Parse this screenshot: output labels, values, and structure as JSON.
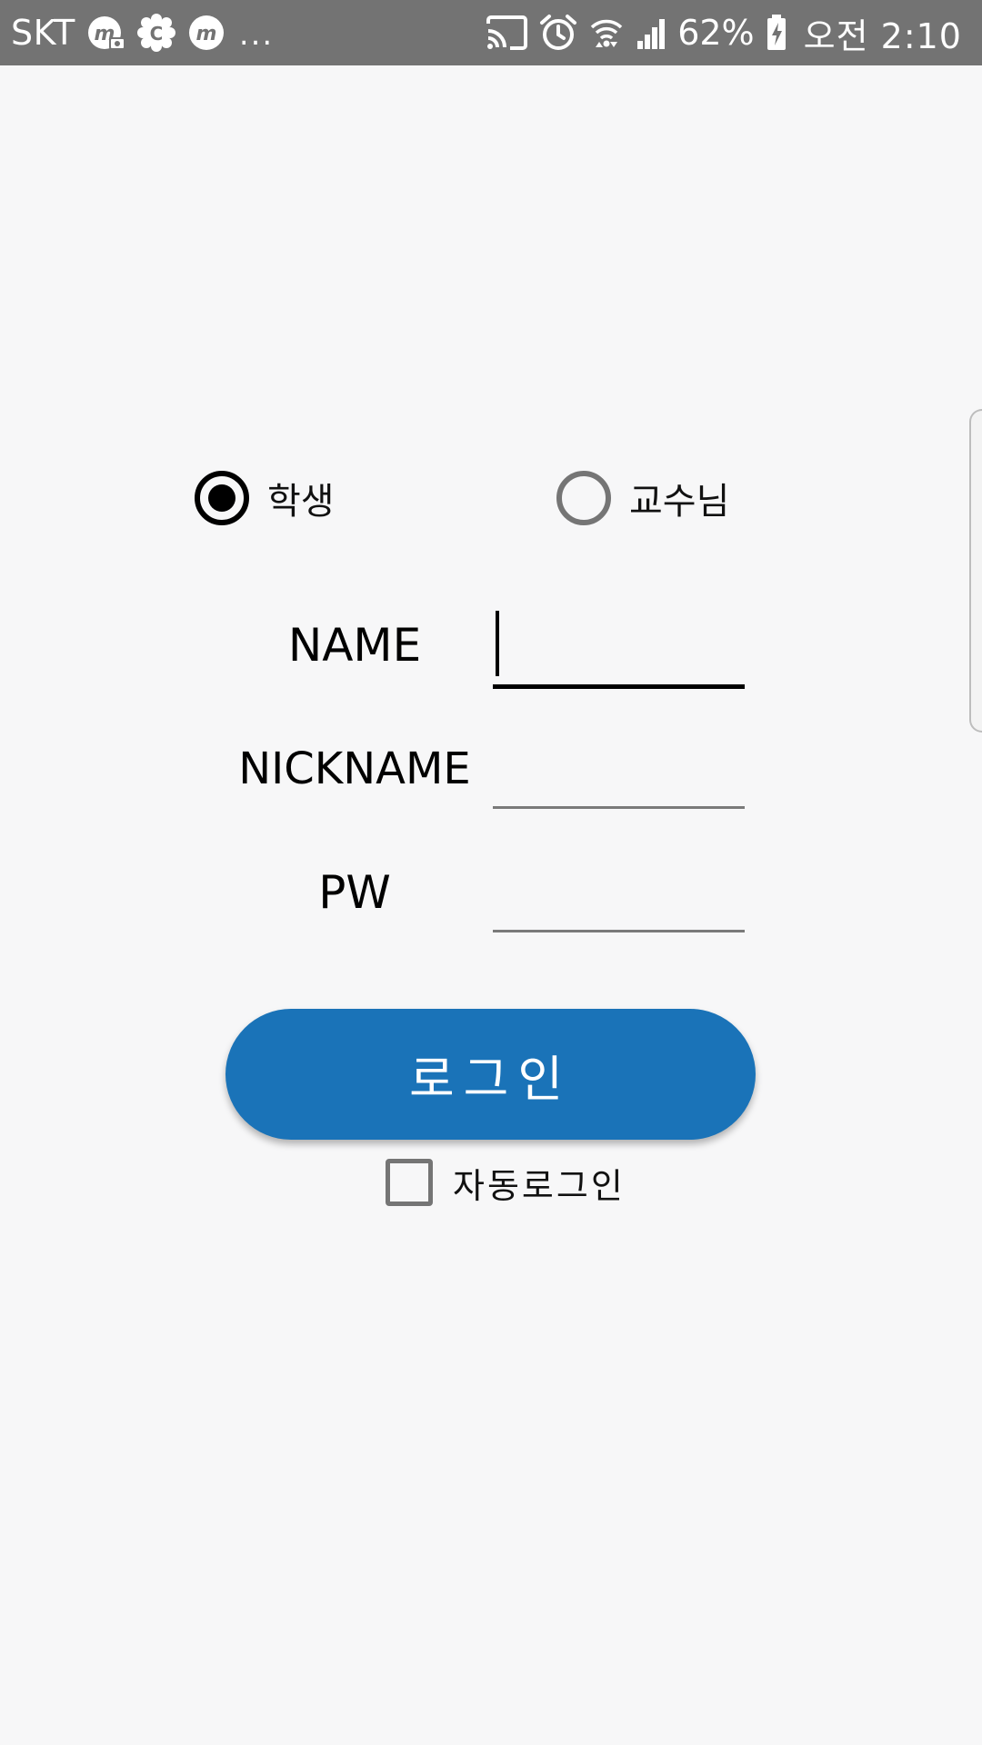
{
  "status_bar": {
    "carrier": "SKT",
    "overflow": "...",
    "battery_percent": "62%",
    "time": "오전 2:10",
    "left_icons": [
      "m-camera-icon",
      "gear-flower-icon",
      "m-icon"
    ],
    "right_icons": [
      "cast-icon",
      "alarm-icon",
      "wifi-icon",
      "signal-icon",
      "battery-charging-icon"
    ]
  },
  "role": {
    "options": [
      {
        "label": "학생",
        "checked": true
      },
      {
        "label": "교수님",
        "checked": false
      }
    ]
  },
  "form": {
    "name_label": "NAME",
    "nickname_label": "NICKNAME",
    "pw_label": "PW",
    "name_value": "",
    "nickname_value": "",
    "pw_value": ""
  },
  "login_button": {
    "label": "로그인"
  },
  "auto_login": {
    "label": "자동로그인",
    "checked": false
  },
  "colors": {
    "status_bar": "#737373",
    "background": "#f7f7f8",
    "primary_button": "#1a73b8",
    "radio_unchecked": "#757575",
    "radio_checked": "#000000"
  }
}
